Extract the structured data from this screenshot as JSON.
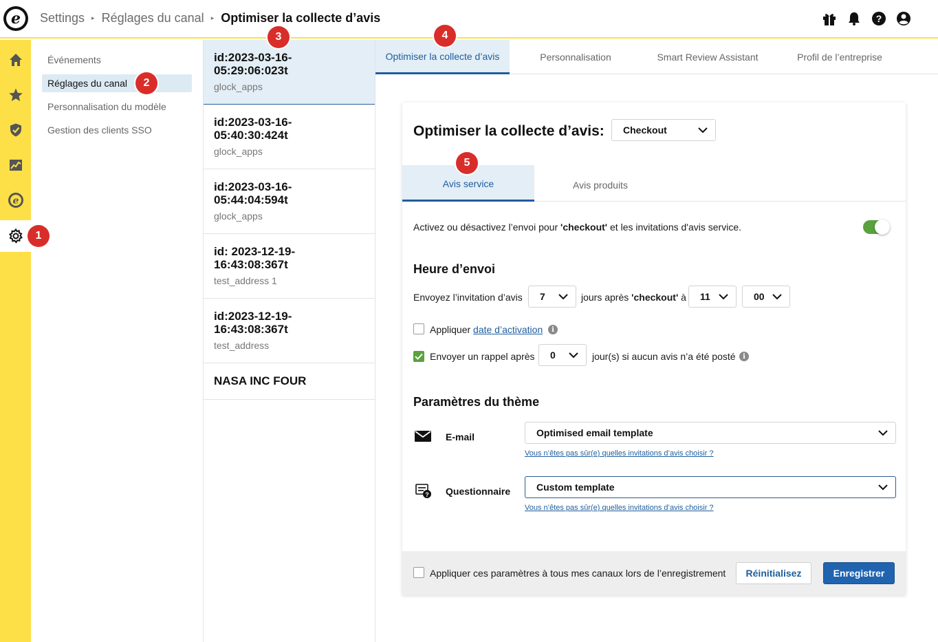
{
  "header": {
    "breadcrumb": [
      "Settings",
      "Réglages du canal",
      "Optimiser la collecte d’avis"
    ]
  },
  "rail": {
    "icons": [
      "home-icon",
      "star-icon",
      "shield-check-icon",
      "analytics-icon",
      "trusted-shops-icon",
      "gear-icon"
    ],
    "active": "gear-icon"
  },
  "subnav": {
    "items": [
      "Événements",
      "Réglages du canal",
      "Personnalisation du modèle",
      "Gestion des clients SSO"
    ],
    "active_index": 1
  },
  "channels": {
    "items": [
      {
        "title": "id:2023-03-16-05:29:06:023t",
        "subtitle": "glock_apps"
      },
      {
        "title": "id:2023-03-16-05:40:30:424t",
        "subtitle": "glock_apps"
      },
      {
        "title": "id:2023-03-16-05:44:04:594t",
        "subtitle": "glock_apps"
      },
      {
        "title": "id: 2023-12-19-16:43:08:367t",
        "subtitle": "test_address 1"
      },
      {
        "title": "id:2023-12-19-16:43:08:367t",
        "subtitle": "test_address"
      },
      {
        "title": "NASA INC FOUR",
        "subtitle": ""
      }
    ],
    "active_index": 0
  },
  "top_tabs": {
    "items": [
      "Optimiser la collecte d’avis",
      "Personnalisation",
      "Smart Review Assistant",
      "Profil de l’entreprise"
    ],
    "active_index": 0
  },
  "card": {
    "title": "Optimiser la collecte d’avis:",
    "trigger_select": "Checkout",
    "inner_tabs": [
      "Avis service",
      "Avis produits"
    ],
    "inner_active_index": 0,
    "activation": {
      "text_before": "Activez ou désactivez l’envoi pour ",
      "bold": "'checkout'",
      "text_after": " et les invitations d'avis service.",
      "enabled": true
    },
    "send_time": {
      "heading": "Heure d’envoi",
      "label_before": "Envoyez l’invitation d’avis",
      "days": "7",
      "label_middle_before": "jours après ",
      "label_middle_bold": "'checkout'",
      "label_middle_after": " à",
      "hour": "11",
      "minute": "00"
    },
    "activation_date": {
      "label": "Appliquer ",
      "link": "date d’activation",
      "checked": false
    },
    "reminder": {
      "label": "Envoyer un rappel après",
      "value": "0",
      "suffix": "jour(s) si aucun avis n’a été posté",
      "checked": true
    },
    "theme": {
      "heading": "Paramètres du thème",
      "email_label": "E-mail",
      "email_template": "Optimised email template",
      "email_help": "Vous n’êtes pas sûr(e) quelles invitations d’avis choisir ?",
      "questionnaire_label": "Questionnaire",
      "questionnaire_template": "Custom template",
      "questionnaire_help": "Vous n’êtes pas sûr(e) quelles invitations d’avis choisir ?"
    },
    "footer": {
      "apply_all": "Appliquer ces paramètres à tous mes canaux lors de l’enregistrement",
      "apply_all_checked": false,
      "reset": "Réinitialisez",
      "save": "Enregistrer"
    }
  },
  "markers": [
    "1",
    "2",
    "3",
    "4",
    "5"
  ],
  "colors": {
    "rail": "#fde047",
    "accent": "#1f5d9c",
    "toggle_on": "#5aa23d",
    "marker": "#d92d2a",
    "save_button": "#2064b0"
  }
}
